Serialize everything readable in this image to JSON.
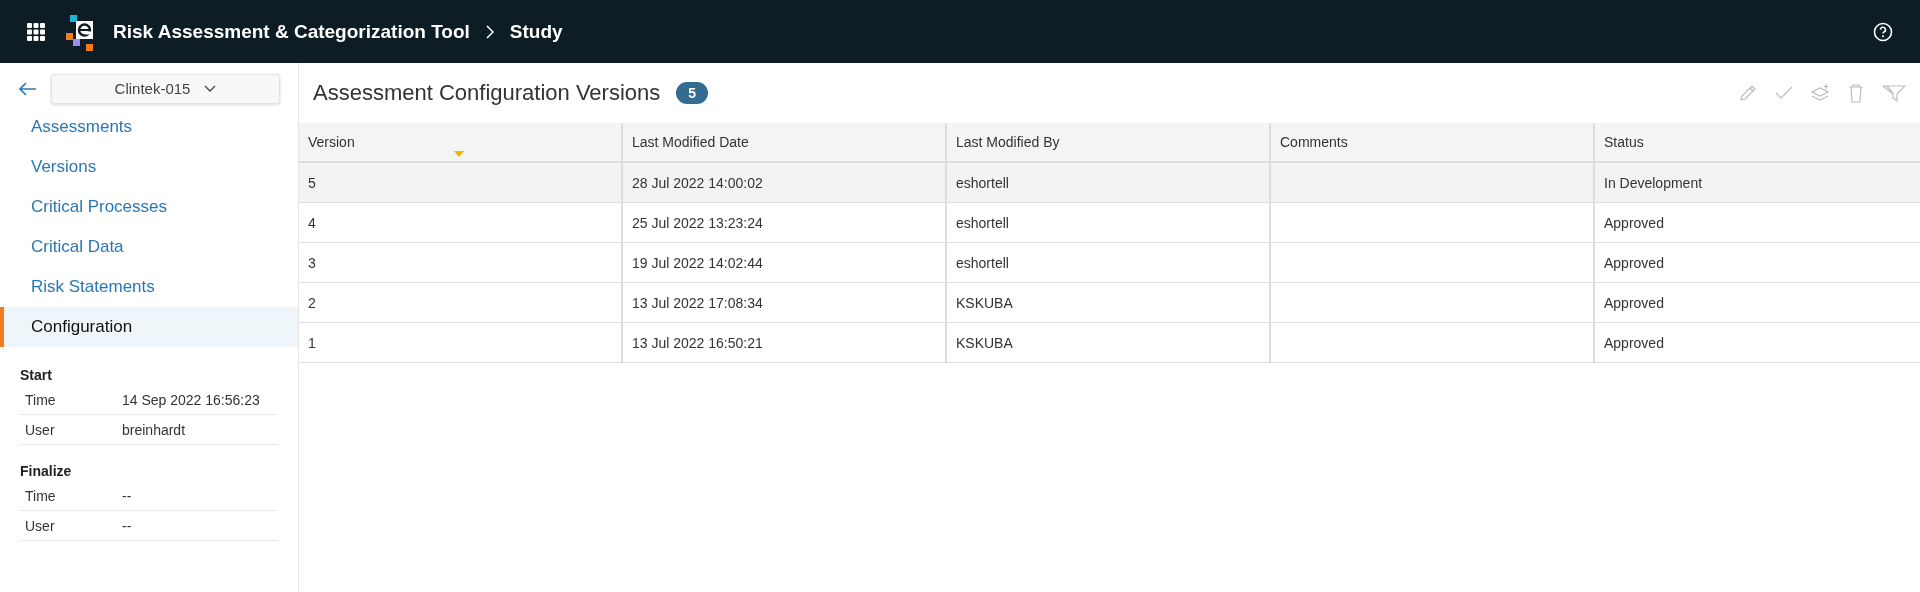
{
  "header": {
    "app_title": "Risk Assessment & Categorization Tool",
    "breadcrumb": "Study"
  },
  "sidebar": {
    "study": "Clintek-015",
    "items": [
      {
        "label": "Assessments",
        "selected": false
      },
      {
        "label": "Versions",
        "selected": false
      },
      {
        "label": "Critical Processes",
        "selected": false
      },
      {
        "label": "Critical Data",
        "selected": false
      },
      {
        "label": "Risk Statements",
        "selected": false
      },
      {
        "label": "Configuration",
        "selected": true
      }
    ],
    "sections": [
      {
        "title": "Start",
        "rows": [
          {
            "label": "Time",
            "value": "14 Sep 2022 16:56:23"
          },
          {
            "label": "User",
            "value": "breinhardt"
          }
        ]
      },
      {
        "title": "Finalize",
        "rows": [
          {
            "label": "Time",
            "value": "--"
          },
          {
            "label": "User",
            "value": "--"
          }
        ]
      }
    ]
  },
  "main": {
    "title": "Assessment Configuration Versions",
    "count": "5",
    "table": {
      "columns": [
        {
          "label": "Version",
          "sorted": true
        },
        {
          "label": "Last Modified Date",
          "sorted": false
        },
        {
          "label": "Last Modified By",
          "sorted": false
        },
        {
          "label": "Comments",
          "sorted": false
        },
        {
          "label": "Status",
          "sorted": false
        }
      ],
      "rows": [
        {
          "cells": [
            "5",
            "28 Jul 2022 14:00:02",
            "eshortell",
            "",
            "In Development"
          ],
          "selected": true
        },
        {
          "cells": [
            "4",
            "25 Jul 2022 13:23:24",
            "eshortell",
            "",
            "Approved"
          ],
          "selected": false
        },
        {
          "cells": [
            "3",
            "19 Jul 2022 14:02:44",
            "eshortell",
            "",
            "Approved"
          ],
          "selected": false
        },
        {
          "cells": [
            "2",
            "13 Jul 2022 17:08:34",
            "KSKUBA",
            "",
            "Approved"
          ],
          "selected": false
        },
        {
          "cells": [
            "1",
            "13 Jul 2022 16:50:21",
            "KSKUBA",
            "",
            "Approved"
          ],
          "selected": false
        }
      ]
    }
  }
}
